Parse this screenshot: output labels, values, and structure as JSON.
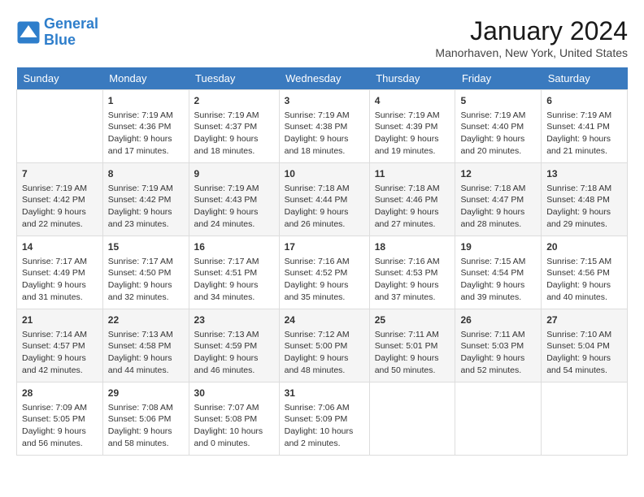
{
  "header": {
    "logo_line1": "General",
    "logo_line2": "Blue",
    "month_title": "January 2024",
    "location": "Manorhaven, New York, United States"
  },
  "days_of_week": [
    "Sunday",
    "Monday",
    "Tuesday",
    "Wednesday",
    "Thursday",
    "Friday",
    "Saturday"
  ],
  "weeks": [
    [
      {
        "day": "",
        "content": ""
      },
      {
        "day": "1",
        "content": "Sunrise: 7:19 AM\nSunset: 4:36 PM\nDaylight: 9 hours\nand 17 minutes."
      },
      {
        "day": "2",
        "content": "Sunrise: 7:19 AM\nSunset: 4:37 PM\nDaylight: 9 hours\nand 18 minutes."
      },
      {
        "day": "3",
        "content": "Sunrise: 7:19 AM\nSunset: 4:38 PM\nDaylight: 9 hours\nand 18 minutes."
      },
      {
        "day": "4",
        "content": "Sunrise: 7:19 AM\nSunset: 4:39 PM\nDaylight: 9 hours\nand 19 minutes."
      },
      {
        "day": "5",
        "content": "Sunrise: 7:19 AM\nSunset: 4:40 PM\nDaylight: 9 hours\nand 20 minutes."
      },
      {
        "day": "6",
        "content": "Sunrise: 7:19 AM\nSunset: 4:41 PM\nDaylight: 9 hours\nand 21 minutes."
      }
    ],
    [
      {
        "day": "7",
        "content": "Sunrise: 7:19 AM\nSunset: 4:42 PM\nDaylight: 9 hours\nand 22 minutes."
      },
      {
        "day": "8",
        "content": "Sunrise: 7:19 AM\nSunset: 4:42 PM\nDaylight: 9 hours\nand 23 minutes."
      },
      {
        "day": "9",
        "content": "Sunrise: 7:19 AM\nSunset: 4:43 PM\nDaylight: 9 hours\nand 24 minutes."
      },
      {
        "day": "10",
        "content": "Sunrise: 7:18 AM\nSunset: 4:44 PM\nDaylight: 9 hours\nand 26 minutes."
      },
      {
        "day": "11",
        "content": "Sunrise: 7:18 AM\nSunset: 4:46 PM\nDaylight: 9 hours\nand 27 minutes."
      },
      {
        "day": "12",
        "content": "Sunrise: 7:18 AM\nSunset: 4:47 PM\nDaylight: 9 hours\nand 28 minutes."
      },
      {
        "day": "13",
        "content": "Sunrise: 7:18 AM\nSunset: 4:48 PM\nDaylight: 9 hours\nand 29 minutes."
      }
    ],
    [
      {
        "day": "14",
        "content": "Sunrise: 7:17 AM\nSunset: 4:49 PM\nDaylight: 9 hours\nand 31 minutes."
      },
      {
        "day": "15",
        "content": "Sunrise: 7:17 AM\nSunset: 4:50 PM\nDaylight: 9 hours\nand 32 minutes."
      },
      {
        "day": "16",
        "content": "Sunrise: 7:17 AM\nSunset: 4:51 PM\nDaylight: 9 hours\nand 34 minutes."
      },
      {
        "day": "17",
        "content": "Sunrise: 7:16 AM\nSunset: 4:52 PM\nDaylight: 9 hours\nand 35 minutes."
      },
      {
        "day": "18",
        "content": "Sunrise: 7:16 AM\nSunset: 4:53 PM\nDaylight: 9 hours\nand 37 minutes."
      },
      {
        "day": "19",
        "content": "Sunrise: 7:15 AM\nSunset: 4:54 PM\nDaylight: 9 hours\nand 39 minutes."
      },
      {
        "day": "20",
        "content": "Sunrise: 7:15 AM\nSunset: 4:56 PM\nDaylight: 9 hours\nand 40 minutes."
      }
    ],
    [
      {
        "day": "21",
        "content": "Sunrise: 7:14 AM\nSunset: 4:57 PM\nDaylight: 9 hours\nand 42 minutes."
      },
      {
        "day": "22",
        "content": "Sunrise: 7:13 AM\nSunset: 4:58 PM\nDaylight: 9 hours\nand 44 minutes."
      },
      {
        "day": "23",
        "content": "Sunrise: 7:13 AM\nSunset: 4:59 PM\nDaylight: 9 hours\nand 46 minutes."
      },
      {
        "day": "24",
        "content": "Sunrise: 7:12 AM\nSunset: 5:00 PM\nDaylight: 9 hours\nand 48 minutes."
      },
      {
        "day": "25",
        "content": "Sunrise: 7:11 AM\nSunset: 5:01 PM\nDaylight: 9 hours\nand 50 minutes."
      },
      {
        "day": "26",
        "content": "Sunrise: 7:11 AM\nSunset: 5:03 PM\nDaylight: 9 hours\nand 52 minutes."
      },
      {
        "day": "27",
        "content": "Sunrise: 7:10 AM\nSunset: 5:04 PM\nDaylight: 9 hours\nand 54 minutes."
      }
    ],
    [
      {
        "day": "28",
        "content": "Sunrise: 7:09 AM\nSunset: 5:05 PM\nDaylight: 9 hours\nand 56 minutes."
      },
      {
        "day": "29",
        "content": "Sunrise: 7:08 AM\nSunset: 5:06 PM\nDaylight: 9 hours\nand 58 minutes."
      },
      {
        "day": "30",
        "content": "Sunrise: 7:07 AM\nSunset: 5:08 PM\nDaylight: 10 hours\nand 0 minutes."
      },
      {
        "day": "31",
        "content": "Sunrise: 7:06 AM\nSunset: 5:09 PM\nDaylight: 10 hours\nand 2 minutes."
      },
      {
        "day": "",
        "content": ""
      },
      {
        "day": "",
        "content": ""
      },
      {
        "day": "",
        "content": ""
      }
    ]
  ]
}
